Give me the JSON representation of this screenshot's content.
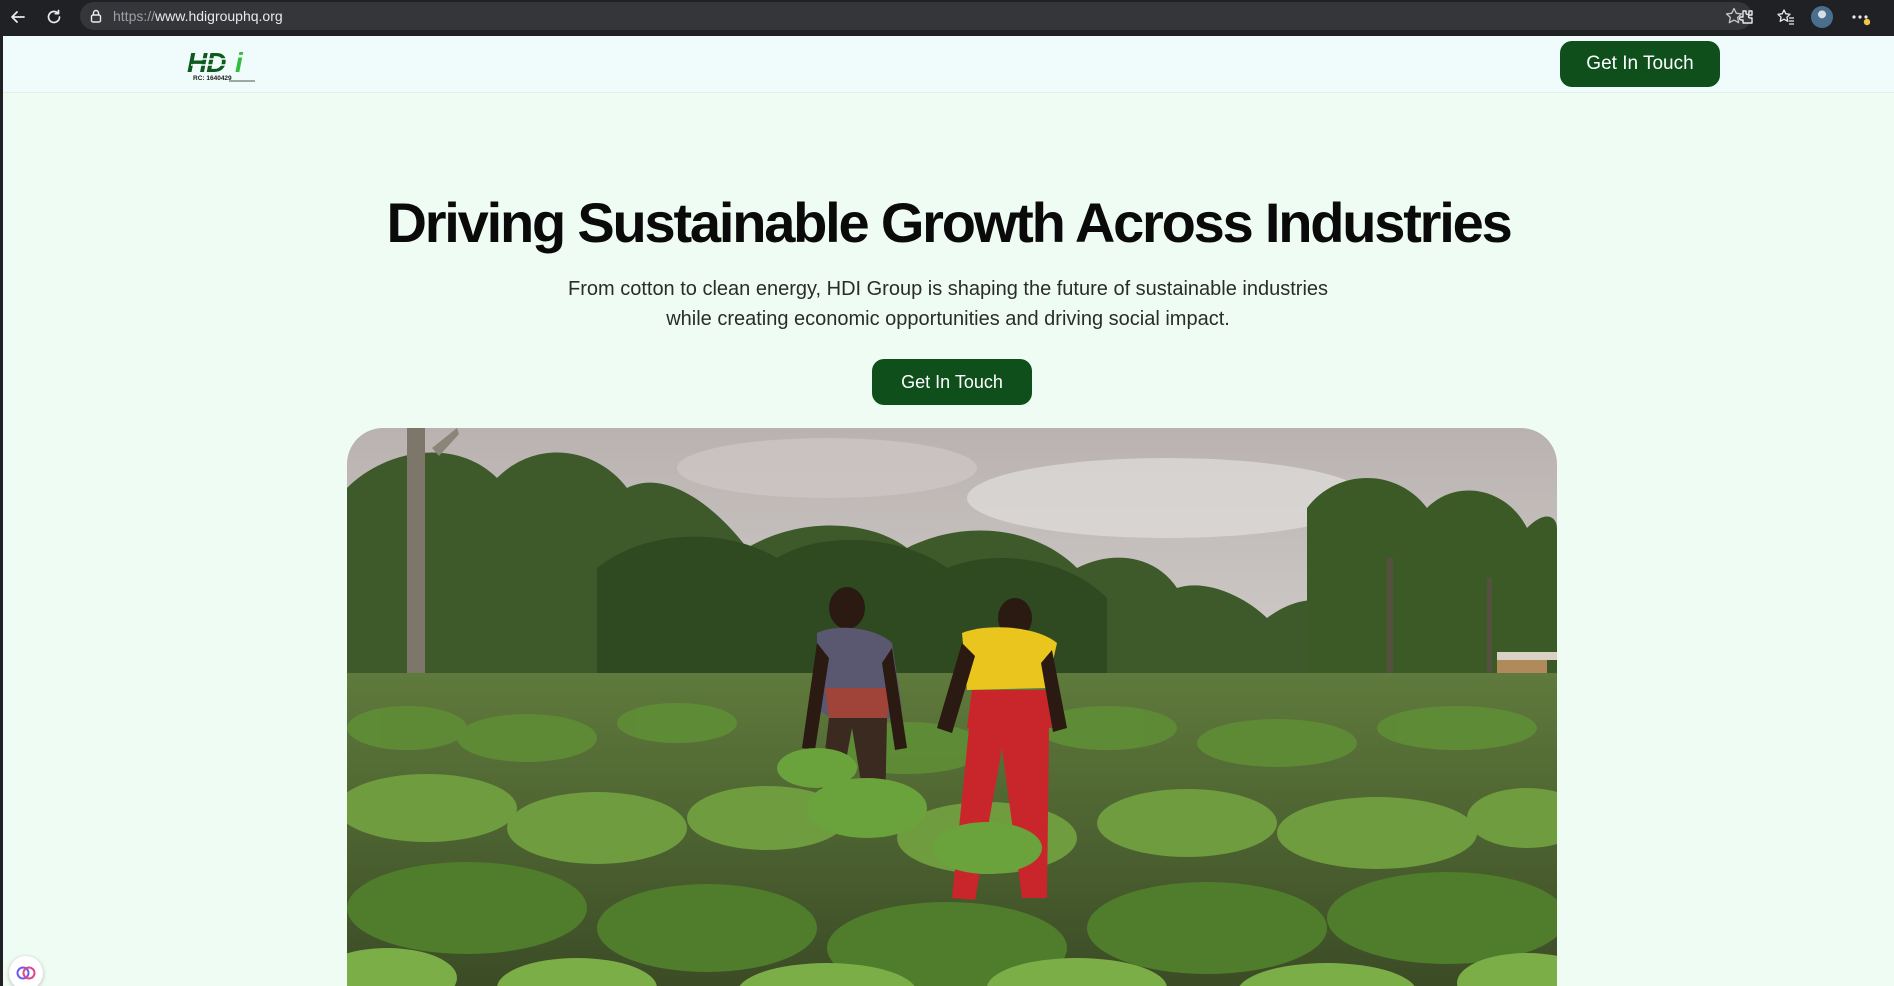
{
  "browser": {
    "url_scheme": "https://",
    "url_host": "www.hdigrouphq.org",
    "icons": [
      "back-arrow-icon",
      "reload-icon",
      "lock-icon",
      "star-icon",
      "extensions-icon",
      "favorites-icon",
      "profile-avatar",
      "more-menu-icon"
    ]
  },
  "header": {
    "logo_text": "HDi",
    "logo_subtext": "RC: 1640429",
    "cta_label": "Get In Touch"
  },
  "hero": {
    "title": "Driving Sustainable Growth Across Industries",
    "subtitle": "From cotton to clean energy, HDI Group is shaping the future of sustainable industries while creating economic opportunities and driving social impact.",
    "cta_label": "Get In Touch",
    "image_alt": "Two farmers tending young cotton plants in a field"
  },
  "colors": {
    "brand_green": "#0f4f1c",
    "page_bg": "#effcf4",
    "header_bg": "#f0fbfb",
    "logo_green": "#2fbf3a",
    "logo_dark": "#0e5a1f"
  }
}
